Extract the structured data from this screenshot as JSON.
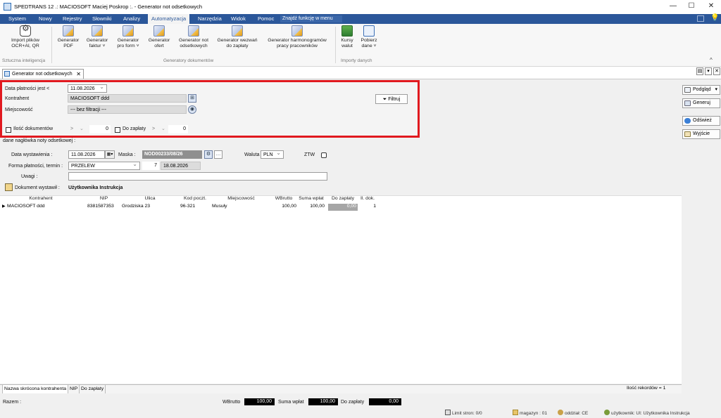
{
  "window": {
    "title": "SPEDTRANS 12 .: MACIOSOFT Maciej Poskrop :. - Generator not odsetkowych",
    "minimize": "—",
    "maximize": "☐",
    "close": "✕"
  },
  "menu": {
    "items": [
      "System",
      "Nowy",
      "Rejestry",
      "Słowniki",
      "Analizy",
      "Automatyzacja",
      "Narzędzia",
      "Widok",
      "Pomoc"
    ],
    "active": "Automatyzacja",
    "find_function": "Znajdź funkcję w menu"
  },
  "ribbon": {
    "buttons": [
      {
        "line1": "Import plików",
        "line2": "OCR+AI, QR",
        "icon": "ai-ocr-icon"
      },
      {
        "line1": "Generator",
        "line2": "PDF",
        "icon": "generator-icon"
      },
      {
        "line1": "Generator",
        "line2": "faktur ˅",
        "icon": "generator-icon"
      },
      {
        "line1": "Generator",
        "line2": "pro form ˅",
        "icon": "generator-icon"
      },
      {
        "line1": "Generator",
        "line2": "ofert",
        "icon": "generator-icon"
      },
      {
        "line1": "Generator not",
        "line2": "odsetkowych",
        "icon": "generator-icon"
      },
      {
        "line1": "Generator wezwań",
        "line2": "do zapłaty",
        "icon": "generator-icon"
      },
      {
        "line1": "Generator harmonogramów",
        "line2": "pracy pracowników",
        "icon": "generator-icon"
      },
      {
        "line1": "Kursy",
        "line2": "walut",
        "icon": "currency-icon"
      },
      {
        "line1": "Pobierz",
        "line2": "dane ˅",
        "icon": "download-data-icon"
      }
    ],
    "groups": [
      "Sztuczna inteligencja",
      "Generatory dokumentów",
      "Importy danych"
    ]
  },
  "doc_tab": {
    "label": "Generator not odsetkowych",
    "close": "✕"
  },
  "filter": {
    "date_label": "Data płatności jest <",
    "date_value": "11.08.2026",
    "contractor_label": "Kontrahent",
    "contractor_value": "MACIOSOFT ddd",
    "city_label": "Miejscowość",
    "city_value": "--- bez filtracji ---",
    "doc_count_label": "Ilość dokumentów",
    "doc_count_op": ">",
    "doc_count_value": "0",
    "to_pay_label": "Do zapłaty",
    "to_pay_op": ">",
    "to_pay_value": "0",
    "filter_button": "Filtruj"
  },
  "side_buttons": {
    "preview": "Podgląd",
    "generate": "Generuj",
    "refresh": "Odśwież",
    "exit": "Wyjście"
  },
  "header": {
    "section_title": "dane nagłówka noty odsetkowej :",
    "issue_date_label": "Data wystawienia :",
    "issue_date_value": "11.08.2026",
    "mask_label": "Maska :",
    "mask_value": "NOD00233/08/26",
    "currency_label": "Waluta",
    "currency_value": "PLN",
    "ztw_label": "ZTW",
    "payment_label": "Forma płatności, termin :",
    "payment_value": "PRZELEW",
    "term_days": "7",
    "term_date": "18.08.2026",
    "notes_label": "Uwagi :",
    "notes_value": "",
    "issued_by_label": "Dokument wystawił :",
    "issued_by_value": "Użytkownika Instrukcja"
  },
  "grid": {
    "columns": [
      "Kontrahent",
      "NIP",
      "Ulica",
      "Kod poczt.",
      "Miejscowość",
      "WBrutto",
      "Suma wpłat",
      "Do zapłaty",
      "Il. dok."
    ],
    "rows": [
      {
        "marker": "▶",
        "kontrahent": "MACIOSOFT ddd",
        "nip": "8381587353",
        "ulica": "Grodziska 23",
        "kod": "96-321",
        "miejscowosc": "Musuły",
        "wbrutto": "100,00",
        "suma_wplat": "100,00",
        "do_zaplaty": "0,00",
        "il_dok": "1"
      }
    ]
  },
  "bottom_tabs": [
    "Nazwa skrócona kontrahenta",
    "NIP",
    "Do zapłaty"
  ],
  "record_count": "Ilość rekordów = 1",
  "totals": {
    "label": "Razem :",
    "wbrutto_label": "WBrutto",
    "wbrutto_value": "100,00",
    "wplat_label": "Suma wpłat",
    "wplat_value": "100,00",
    "zaplaty_label": "Do zapłaty",
    "zaplaty_value": "0,00"
  },
  "status": {
    "page_limit": "Limit stron: 0/0",
    "warehouse": "magazyn : 01",
    "branch": "oddział: CE",
    "user": "użytkownik: UI: Użytkownika Instrukcja"
  }
}
